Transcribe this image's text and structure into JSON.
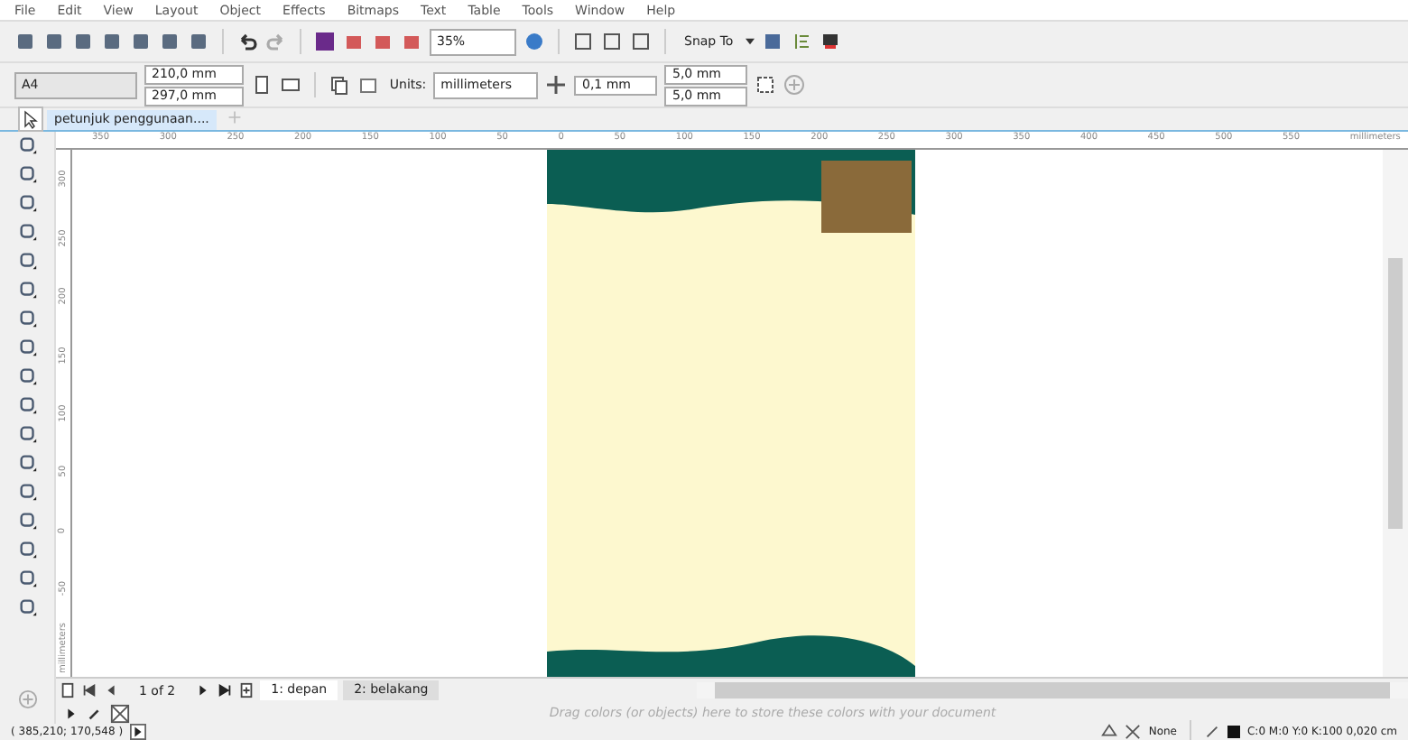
{
  "menu": [
    "File",
    "Edit",
    "View",
    "Layout",
    "Object",
    "Effects",
    "Bitmaps",
    "Text",
    "Table",
    "Tools",
    "Window",
    "Help"
  ],
  "toolbar": {
    "zoom": "35%",
    "snap": "Snap To"
  },
  "property_bar": {
    "page_size": "A4",
    "width": "210,0 mm",
    "height": "297,0 mm",
    "units_label": "Units:",
    "units": "millimeters",
    "nudge": "0,1 mm",
    "duplicate_x": "5,0 mm",
    "duplicate_y": "5,0 mm"
  },
  "document_tabs": [
    {
      "label": "petunjuk penggunaan....",
      "selected": true
    }
  ],
  "horizontal_ruler": {
    "labels": [
      "350",
      "300",
      "250",
      "200",
      "150",
      "100",
      "50",
      "0",
      "50",
      "100",
      "150",
      "200",
      "250",
      "300",
      "350",
      "400",
      "450",
      "500",
      "550"
    ],
    "unit": "millimeters"
  },
  "vertical_ruler": {
    "labels": [
      "300",
      "250",
      "200",
      "150",
      "100",
      "50",
      "0",
      "-50"
    ],
    "unit": "millimeters"
  },
  "page_navigator": {
    "counter": "1 of 2",
    "pages": [
      {
        "label": "1: depan",
        "selected": true
      },
      {
        "label": "2: belakang",
        "selected": false
      }
    ]
  },
  "palette": {
    "hint": "Drag colors (or objects) here to store these colors with your document"
  },
  "status_bar": {
    "coordinates": "( 385,210; 170,548 )",
    "fill": "None",
    "outline": "C:0 M:0 Y:0 K:100 0,020 cm"
  }
}
